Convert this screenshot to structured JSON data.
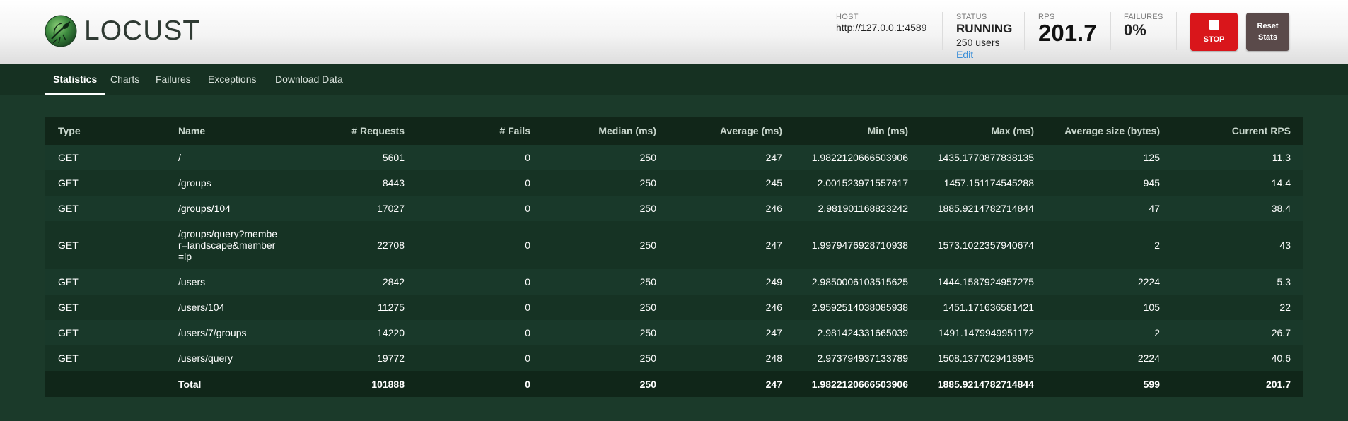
{
  "app": {
    "logo_text": "LOCUST"
  },
  "header": {
    "host_label": "HOST",
    "host_value": "http://127.0.0.1:4589",
    "status_label": "STATUS",
    "status_value": "RUNNING",
    "users_value": "250 users",
    "edit_label": "Edit",
    "rps_label": "RPS",
    "rps_value": "201.7",
    "failures_label": "FAILURES",
    "failures_value": "0%",
    "stop_label": "STOP",
    "reset_label": "Reset Stats"
  },
  "tabs": [
    {
      "label": "Statistics",
      "active": true
    },
    {
      "label": "Charts",
      "active": false
    },
    {
      "label": "Failures",
      "active": false
    },
    {
      "label": "Exceptions",
      "active": false
    },
    {
      "label": "Download Data",
      "active": false
    }
  ],
  "table": {
    "columns": [
      "Type",
      "Name",
      "# Requests",
      "# Fails",
      "Median (ms)",
      "Average (ms)",
      "Min (ms)",
      "Max (ms)",
      "Average size (bytes)",
      "Current RPS"
    ],
    "rows": [
      [
        "GET",
        "/",
        "5601",
        "0",
        "250",
        "247",
        "1.9822120666503906",
        "1435.1770877838135",
        "125",
        "11.3"
      ],
      [
        "GET",
        "/groups",
        "8443",
        "0",
        "250",
        "245",
        "2.001523971557617",
        "1457.151174545288",
        "945",
        "14.4"
      ],
      [
        "GET",
        "/groups/104",
        "17027",
        "0",
        "250",
        "246",
        "2.981901168823242",
        "1885.9214782714844",
        "47",
        "38.4"
      ],
      [
        "GET",
        "/groups/query?member=landscape&member=lp",
        "22708",
        "0",
        "250",
        "247",
        "1.9979476928710938",
        "1573.1022357940674",
        "2",
        "43"
      ],
      [
        "GET",
        "/users",
        "2842",
        "0",
        "250",
        "249",
        "2.9850006103515625",
        "1444.1587924957275",
        "2224",
        "5.3"
      ],
      [
        "GET",
        "/users/104",
        "11275",
        "0",
        "250",
        "246",
        "2.9592514038085938",
        "1451.171636581421",
        "105",
        "22"
      ],
      [
        "GET",
        "/users/7/groups",
        "14220",
        "0",
        "250",
        "247",
        "2.981424331665039",
        "1491.1479949951172",
        "2",
        "26.7"
      ],
      [
        "GET",
        "/users/query",
        "19772",
        "0",
        "250",
        "248",
        "2.973794937133789",
        "1508.1377029418945",
        "2224",
        "40.6"
      ]
    ],
    "total": [
      "",
      "Total",
      "101888",
      "0",
      "250",
      "247",
      "1.9822120666503906",
      "1885.9214782714844",
      "599",
      "201.7"
    ]
  },
  "colors": {
    "background": "#1b3a2a",
    "navbar": "#163122",
    "stop_button": "#d9161b",
    "reset_button": "#5a4a4a",
    "edit_link": "#3b8fd8"
  }
}
